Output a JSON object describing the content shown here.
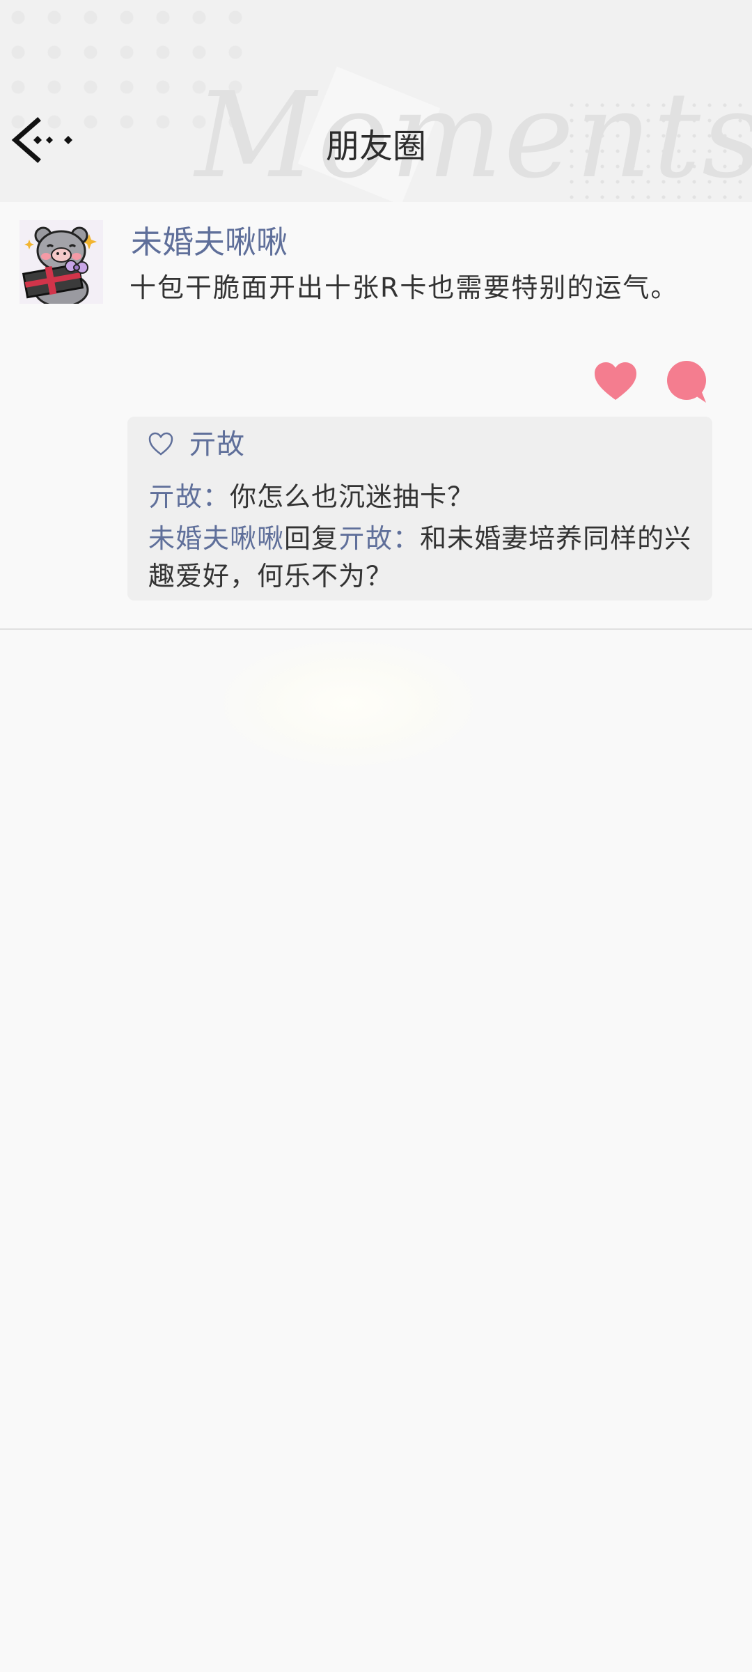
{
  "header": {
    "title": "朋友圈",
    "watermark": "Moments"
  },
  "post": {
    "author": "未婚夫啾啾",
    "text": "十包干脆面开出十张R卡也需要特别的运气。",
    "likes": {
      "names": [
        "亓故"
      ]
    },
    "comments": [
      {
        "author": "亓故",
        "separator": "：",
        "text": "你怎么也沉迷抽卡？"
      },
      {
        "author": "未婚夫啾啾",
        "reply_word": "回复",
        "reply_to": "亓故",
        "separator": "：",
        "text": "和未婚妻培养同样的兴趣爱好，何乐不为？"
      }
    ]
  },
  "colors": {
    "accent_name": "#5f6f9a",
    "like_heart": "#f47d8f",
    "comment_bubble": "#f47d8f",
    "background": "#f9f9f9"
  },
  "icons": {
    "back": "back-arrow-icon",
    "like": "heart-icon",
    "comment": "comment-bubble-icon",
    "likes_marker": "heart-outline-icon"
  }
}
